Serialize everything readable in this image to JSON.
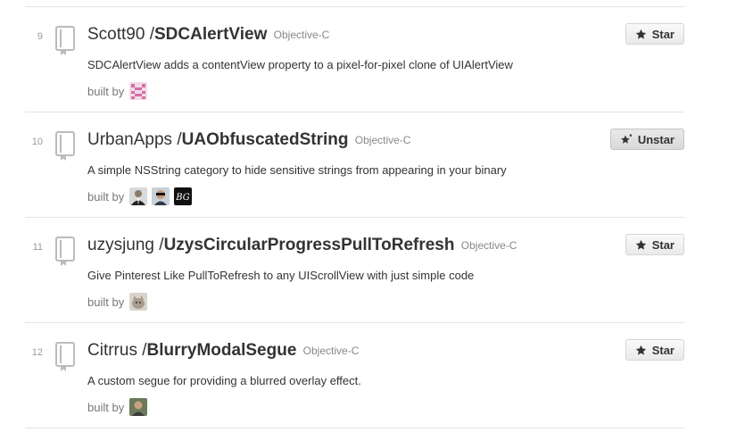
{
  "repos": [
    {
      "rank": "9",
      "owner": "Scott90",
      "slash": "/",
      "name": "SDCAlertView",
      "language": "Objective-C",
      "description": "SDCAlertView adds a contentView property to a pixel-for-pixel clone of UIAlertView",
      "built_by_label": "built by",
      "star_label": "Star",
      "starred": false,
      "avatars": [
        "identicon-pink"
      ]
    },
    {
      "rank": "10",
      "owner": "UrbanApps",
      "slash": "/",
      "name": "UAObfuscatedString",
      "language": "Objective-C",
      "description": "A simple NSString category to hide sensitive strings from appearing in your binary",
      "built_by_label": "built by",
      "star_label": "Unstar",
      "starred": true,
      "avatars": [
        "photo-suit",
        "photo-sunglasses",
        "logo-bg"
      ]
    },
    {
      "rank": "11",
      "owner": "uzysjung",
      "slash": "/",
      "name": "UzysCircularProgressPullToRefresh",
      "language": "Objective-C",
      "description": "Give Pinterest Like PullToRefresh to any UIScrollView with just simple code",
      "built_by_label": "built by",
      "star_label": "Star",
      "starred": false,
      "avatars": [
        "photo-cat"
      ]
    },
    {
      "rank": "12",
      "owner": "Citrrus",
      "slash": "/",
      "name": "BlurryModalSegue",
      "language": "Objective-C",
      "description": "A custom segue for providing a blurred overlay effect.",
      "built_by_label": "built by",
      "star_label": "Star",
      "starred": false,
      "avatars": [
        "photo-man"
      ]
    }
  ],
  "colors": {
    "text": "#333333",
    "muted": "#888888",
    "divider": "#e5e5e5",
    "icon": "#bbbbbb"
  }
}
